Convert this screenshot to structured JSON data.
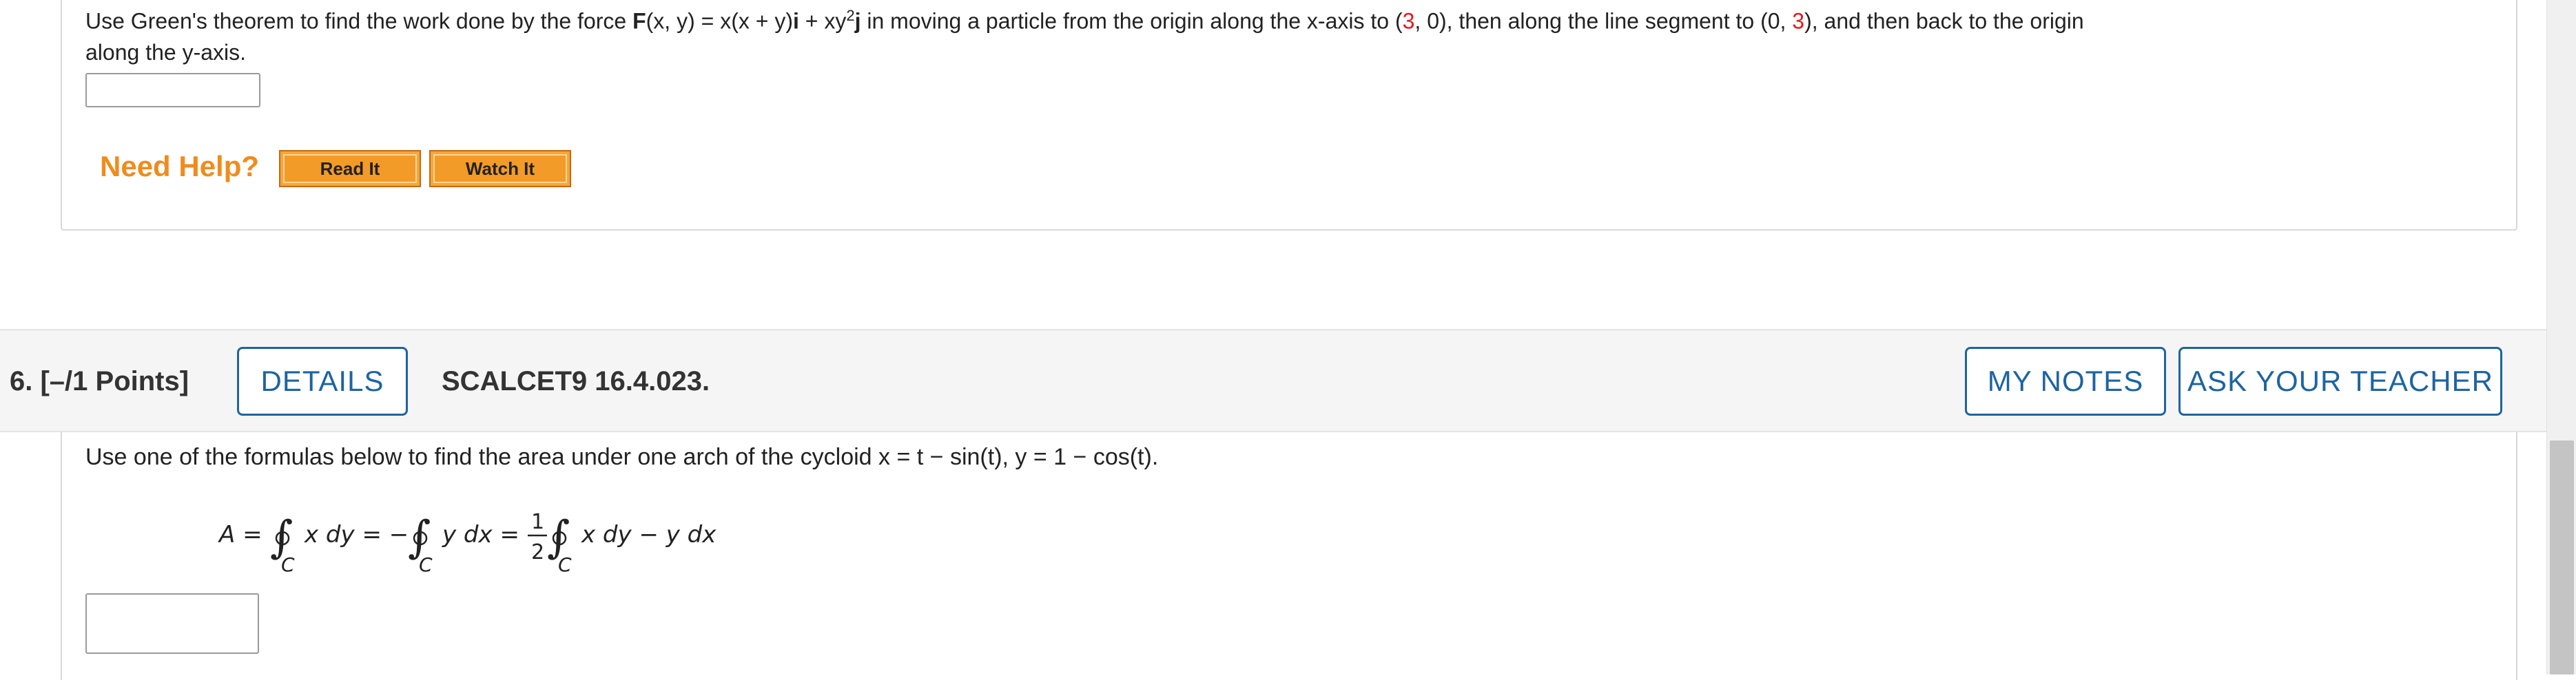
{
  "previous_question": {
    "text_part1": "Use Green's theorem to find the work done by the force ",
    "force_symbol": "F",
    "force_args": "(x, y) = x(x + y)",
    "i_vec": "i",
    "plus": " + xy",
    "sup": "2",
    "j_vec": "j",
    "text_part2": " in moving a particle from the origin along the x-axis to (",
    "point1_x": "3",
    "text_part3": ", 0), then along the line segment to (0, ",
    "point2_y": "3",
    "text_part4": "), and then back to the origin",
    "text_line2": "along the y-axis.",
    "answer_value": "",
    "need_help_label": "Need Help?",
    "read_it_label": "Read It",
    "watch_it_label": "Watch It"
  },
  "question_header": {
    "number_label": "6.  [–/1 Points]",
    "details_label": "DETAILS",
    "code_label": "SCALCET9 16.4.023.",
    "my_notes_label": "MY NOTES",
    "ask_teacher_label": "ASK YOUR TEACHER"
  },
  "question": {
    "text": "Use one of the formulas below to find the area under one arch of the cycloid x = t − sin(t), y = 1 − cos(t).",
    "formula": {
      "lhs": "A =",
      "term1": "x dy = −",
      "term2": "y dx =",
      "frac_num": "1",
      "frac_den": "2",
      "term3": "x dy − y dx",
      "contour_sub": "C"
    },
    "answer_value": ""
  },
  "colors": {
    "accent_blue": "#1e64a0",
    "help_orange": "#f08c1c",
    "highlight_red": "#e21b1b"
  }
}
